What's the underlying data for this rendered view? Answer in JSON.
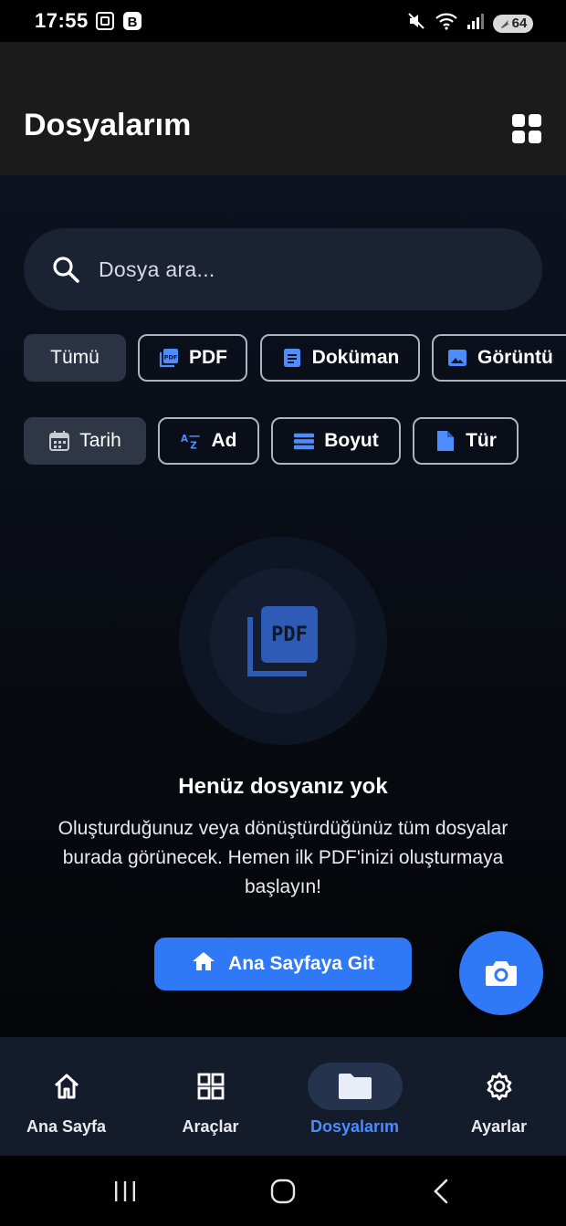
{
  "status_bar": {
    "time": "17:55",
    "battery": "64",
    "left_icons": [
      "screenshot-icon",
      "b-app-icon"
    ],
    "right_icons": [
      "mute-icon",
      "wifi-icon",
      "signal-icon",
      "battery-icon"
    ]
  },
  "app_bar": {
    "title": "Dosyalarım",
    "grid_icon": "grid-view-icon"
  },
  "search": {
    "placeholder": "Dosya ara..."
  },
  "filters": [
    {
      "label": "Tümü",
      "icon": null,
      "selected": true
    },
    {
      "label": "PDF",
      "icon": "pdf-icon",
      "selected": false
    },
    {
      "label": "Doküman",
      "icon": "document-icon",
      "selected": false
    },
    {
      "label": "Görüntü",
      "icon": "image-icon",
      "selected": false
    }
  ],
  "sorts": [
    {
      "label": "Tarih",
      "icon": "calendar-icon",
      "selected": true
    },
    {
      "label": "Ad",
      "icon": "sort-az-icon",
      "selected": false
    },
    {
      "label": "Boyut",
      "icon": "storage-icon",
      "selected": false
    },
    {
      "label": "Tür",
      "icon": "file-icon",
      "selected": false
    }
  ],
  "empty_state": {
    "icon": "pdf-stack-icon",
    "title": "Henüz dosyanız yok",
    "description": "Oluşturduğunuz veya dönüştürdüğünüz tüm dosyalar burada görünecek. Hemen ilk PDF'inizi oluşturmaya başlayın!",
    "button_label": "Ana Sayfaya Git",
    "button_icon": "home-icon"
  },
  "fab": {
    "icon": "camera-icon"
  },
  "bottom_nav": {
    "items": [
      {
        "label": "Ana Sayfa",
        "icon": "home-outline-icon",
        "active": false
      },
      {
        "label": "Araçlar",
        "icon": "tools-grid-icon",
        "active": false
      },
      {
        "label": "Dosyalarım",
        "icon": "folder-icon",
        "active": true
      },
      {
        "label": "Ayarlar",
        "icon": "settings-gear-icon",
        "active": false
      }
    ]
  },
  "colors": {
    "accent": "#2f78f6",
    "active_nav_text": "#4a8cff",
    "app_bar": "#1b1b1b",
    "nav_bg": "#141b2a"
  }
}
